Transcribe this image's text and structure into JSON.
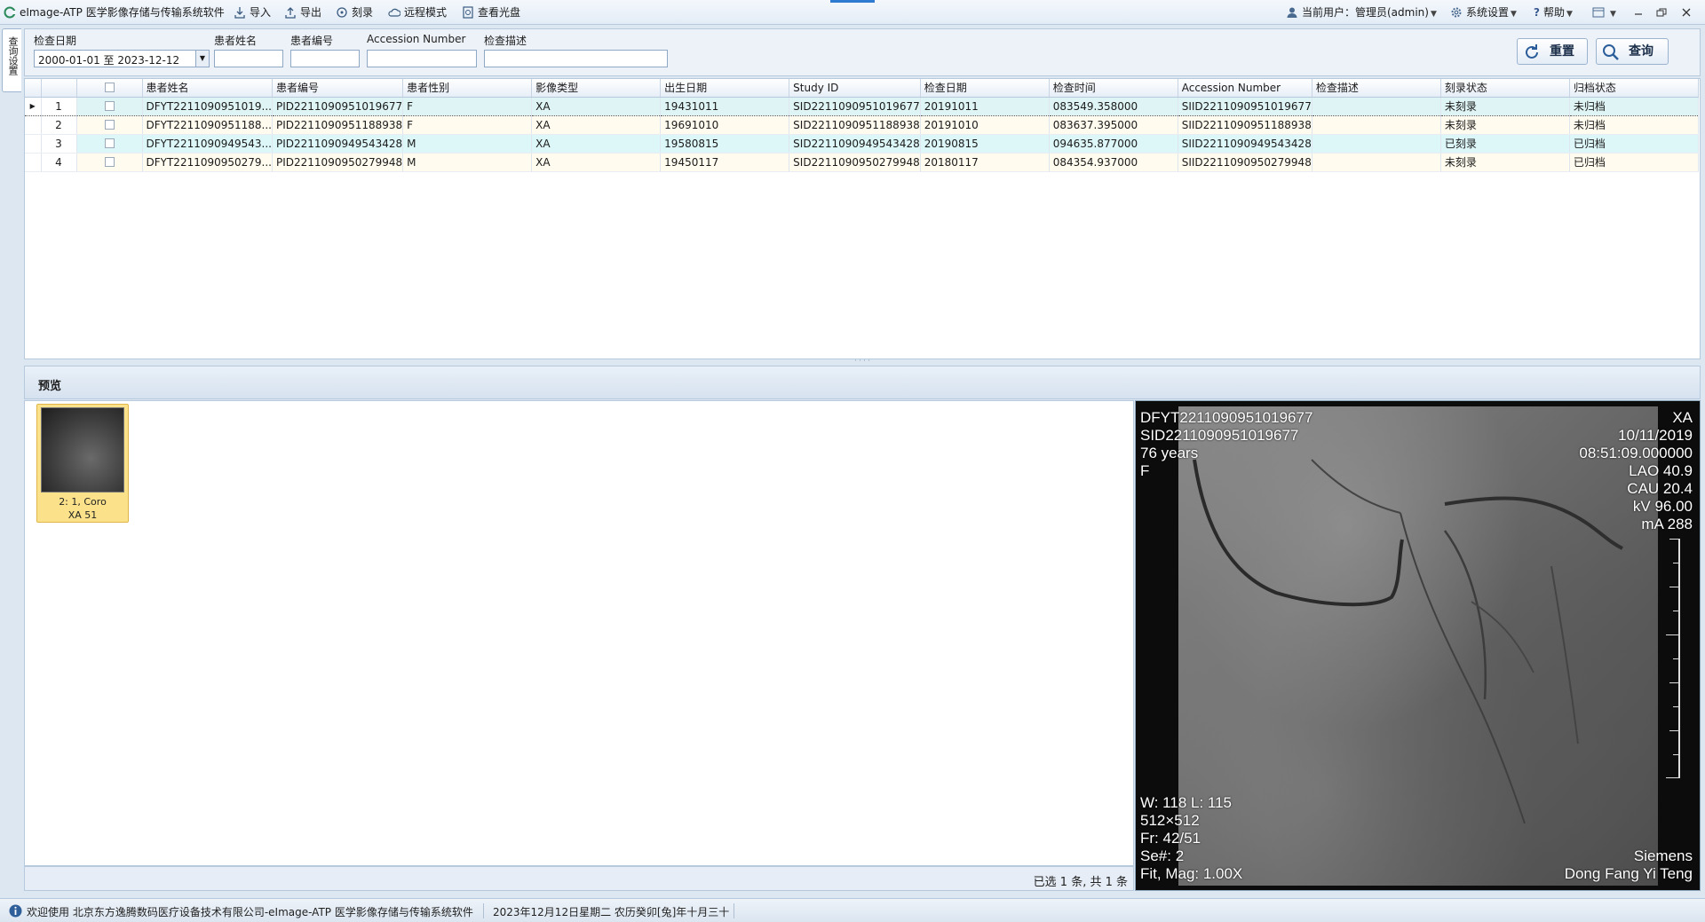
{
  "menubar": {
    "app_title": "eImage-ATP 医学影像存储与传输系统软件",
    "import": "导入",
    "export": "导出",
    "burn": "刻录",
    "remote": "远程模式",
    "view_disc": "查看光盘",
    "current_user": "当前用户：管理员(admin)",
    "settings": "系统设置",
    "help": "帮助"
  },
  "side_tab": "查询设置",
  "search": {
    "date_label": "检查日期",
    "date_value": "2000-01-01 至 2023-12-12",
    "name_label": "患者姓名",
    "id_label": "患者编号",
    "accession_label": "Accession Number",
    "desc_label": "检查描述",
    "reset_button": "重置",
    "query_button": "查询"
  },
  "grid": {
    "columns": [
      "患者姓名",
      "患者编号",
      "患者性别",
      "影像类型",
      "出生日期",
      "Study ID",
      "检查日期",
      "检查时间",
      "Accession Number",
      "检查描述",
      "刻录状态",
      "归档状态"
    ],
    "rows": [
      {
        "num": "1",
        "name": "DFYT2211090951019...",
        "pid": "PID2211090951019677",
        "sex": "F",
        "modality": "XA",
        "birth": "19431011",
        "study_id": "SID2211090951019677",
        "date": "20191011",
        "time": "083549.358000",
        "accession": "SIID2211090951019677",
        "desc": "",
        "burn": "未刻录",
        "archive": "未归档"
      },
      {
        "num": "2",
        "name": "DFYT2211090951188...",
        "pid": "PID2211090951188938",
        "sex": "F",
        "modality": "XA",
        "birth": "19691010",
        "study_id": "SID2211090951188938",
        "date": "20191010",
        "time": "083637.395000",
        "accession": "SIID2211090951188938",
        "desc": "",
        "burn": "未刻录",
        "archive": "未归档"
      },
      {
        "num": "3",
        "name": "DFYT2211090949543...",
        "pid": "PID2211090949543428",
        "sex": "M",
        "modality": "XA",
        "birth": "19580815",
        "study_id": "SID2211090949543428",
        "date": "20190815",
        "time": "094635.877000",
        "accession": "SIID2211090949543428",
        "desc": "",
        "burn": "已刻录",
        "archive": "已归档"
      },
      {
        "num": "4",
        "name": "DFYT2211090950279...",
        "pid": "PID2211090950279948",
        "sex": "M",
        "modality": "XA",
        "birth": "19450117",
        "study_id": "SID2211090950279948",
        "date": "20180117",
        "time": "084354.937000",
        "accession": "SIID2211090950279948",
        "desc": "",
        "burn": "未刻录",
        "archive": "已归档"
      }
    ]
  },
  "preview": {
    "header": "预览",
    "thumb_line1": "2: 1, Coro",
    "thumb_line2": "XA  51",
    "selection_status": "已选 1 条, 共 1 条"
  },
  "viewer": {
    "patient": "DFYT2211090951019677",
    "study": "SID2211090951019677",
    "age": "76 years",
    "sex": "F",
    "modality": "XA",
    "date": "10/11/2019",
    "time": "08:51:09.000000",
    "lao": "LAO 40.9",
    "cau": "CAU 20.4",
    "kv": "kV 96.00",
    "ma": "mA 288",
    "wl": "W: 118 L: 115",
    "matrix": "512×512",
    "frame": "Fr: 42/51",
    "series": "Se#: 2",
    "fit": "Fit, Mag: 1.00X",
    "manufacturer": "Siemens",
    "institution": "Dong Fang Yi Teng"
  },
  "statusbar": {
    "welcome": "欢迎使用 北京东方逸腾数码医疗设备技术有限公司-eImage-ATP 医学影像存储与传输系统软件",
    "datetime": "2023年12月12日星期二 农历癸卯[兔]年十月三十"
  },
  "colors": {
    "accent": "#2f7bd1",
    "thumb_selected": "#fbe28a",
    "row_selected": "#dff4f4",
    "row_alt": "#ddf7f9",
    "row_normal": "#fffbee"
  }
}
